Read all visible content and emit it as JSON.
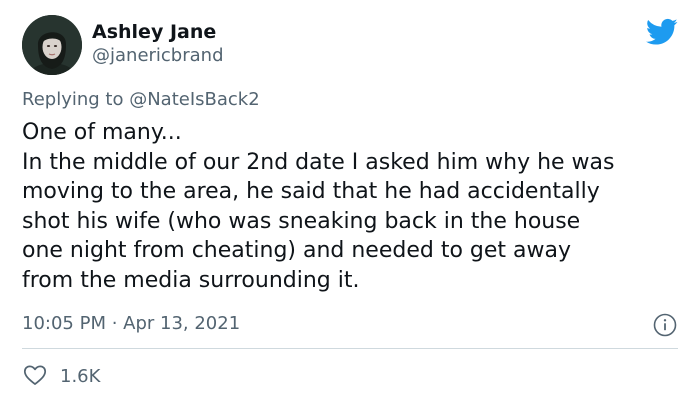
{
  "author": {
    "name": "Ashley Jane",
    "handle": "@janericbrand"
  },
  "reply": {
    "prefix": "Replying to ",
    "mention": "@NateIsBack2"
  },
  "body_lines": [
    "One of many...",
    "In the middle of our 2nd date I asked him why he was",
    "moving to the area, he said that he had accidentally",
    "shot his wife (who was sneaking back in the house",
    "one night from cheating) and needed to get away",
    "from the media surrounding it."
  ],
  "timestamp": "10:05 PM · Apr 13, 2021",
  "likes": "1.6K",
  "icons": {
    "brand": "twitter-bird-icon",
    "info": "info-icon",
    "like": "heart-icon"
  },
  "colors": {
    "brand_blue": "#1d9bf0",
    "secondary_text": "#536471",
    "primary_text": "#0f1419",
    "divider": "#cfd9de"
  }
}
